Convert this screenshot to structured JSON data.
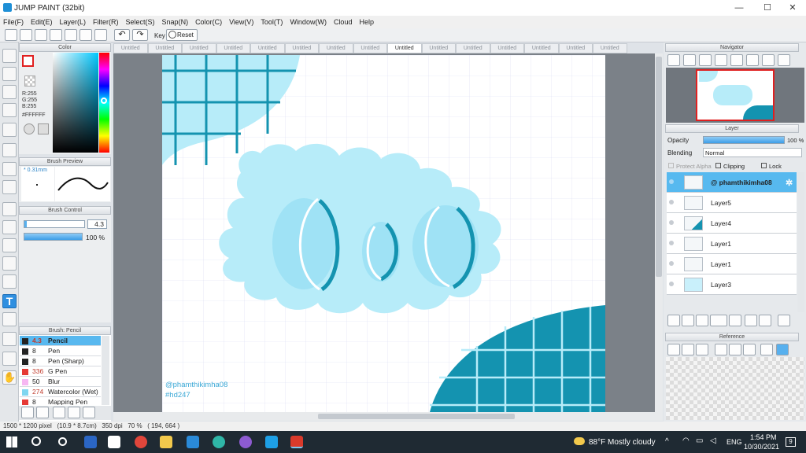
{
  "window": {
    "title": "JUMP PAINT (32bit)"
  },
  "menu": [
    "File(F)",
    "Edit(E)",
    "Layer(L)",
    "Filter(R)",
    "Select(S)",
    "Snap(N)",
    "Color(C)",
    "View(V)",
    "Tool(T)",
    "Window(W)",
    "Cloud",
    "Help"
  ],
  "toolbar": {
    "key_label": "Key",
    "reset_label": "Reset"
  },
  "panels": {
    "color": "Color",
    "brush_preview": "Brush Preview",
    "brush_control": "Brush Control",
    "brush_list": "Brush: Pencil",
    "navigator": "Navigator",
    "layer": "Layer",
    "reference": "Reference"
  },
  "color": {
    "r": "R:255",
    "g": "G:255",
    "b": "B:255",
    "hex": "#FFFFFF"
  },
  "brush_preview": {
    "size": "* 0.31mm"
  },
  "brush_control": {
    "size": "4.3",
    "opacity": "100 %"
  },
  "brushes": [
    {
      "size": "4.3",
      "name": "Pencil",
      "color": "#222222"
    },
    {
      "size": "8",
      "name": "Pen",
      "color": "#222222"
    },
    {
      "size": "8",
      "name": "Pen (Sharp)",
      "color": "#222222"
    },
    {
      "size": "336",
      "name": "G Pen",
      "color": "#e53935"
    },
    {
      "size": "50",
      "name": "Blur",
      "color": "#f6b7f2"
    },
    {
      "size": "274",
      "name": "Watercolor (Wet)",
      "color": "#7fd6f0"
    },
    {
      "size": "8",
      "name": "Mapping Pen",
      "color": "#e53935"
    }
  ],
  "tabs": [
    "Untitled",
    "Untitled",
    "Untitled",
    "Untitled",
    "Untitled",
    "Untitled",
    "Untitled",
    "Untitled",
    "Untitled",
    "Untitled",
    "Untitled",
    "Untitled",
    "Untitled",
    "Untitled",
    "Untitled"
  ],
  "active_tab": 8,
  "canvas": {
    "watermark_line1": "@phamthikimha08",
    "watermark_line2": "#hd247",
    "accent": "#1493b0",
    "light": "#b7ecf9"
  },
  "layer_panel": {
    "opacity_label": "Opacity",
    "opacity_value": "100 %",
    "blending_label": "Blending",
    "blending_value": "Normal",
    "protect_alpha": "Protect Alpha",
    "clipping": "Clipping",
    "lock": "Lock",
    "layers": [
      "@ phamthikimha08",
      "Layer5",
      "Layer4",
      "Layer1",
      "Layer1",
      "Layer3"
    ]
  },
  "status": {
    "text": "1500 * 1200 pixel   (10.9 * 8.7cm)   350 dpi   70 %   ( 194, 664 )"
  },
  "taskbar": {
    "weather": "88°F  Mostly cloudy",
    "lang": "ENG",
    "time": "1:54 PM",
    "date": "10/30/2021",
    "notifications": "9"
  }
}
